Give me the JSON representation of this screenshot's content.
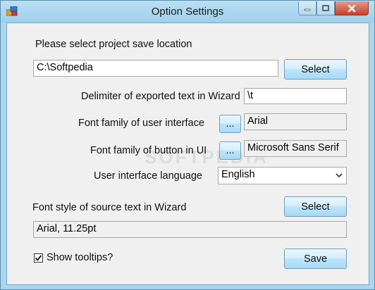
{
  "window": {
    "title": "Option Settings"
  },
  "save_location": {
    "label": "Please select project save location",
    "value": "C:\\Softpedia",
    "select_label": "Select"
  },
  "delimiter": {
    "label": "Delimiter of exported text in Wizard",
    "value": "\\t"
  },
  "ui_font": {
    "label": "Font family of user interface",
    "browse_label": "...",
    "value": "Arial"
  },
  "button_font": {
    "label": "Font family of button in UI",
    "browse_label": "...",
    "value": "Microsoft Sans Serif"
  },
  "language": {
    "label": "User interface language",
    "selected": "English"
  },
  "source_font": {
    "label": "Font style of source text in Wizard",
    "select_label": "Select",
    "value": "Arial, 11.25pt"
  },
  "tooltips": {
    "label": "Show tooltips?",
    "checked": true
  },
  "actions": {
    "save_label": "Save"
  },
  "watermark": "SOFTPEDIA",
  "colors": {
    "frame": "#a9d6f0",
    "button_top": "#eaf6fd",
    "button_bottom": "#a7d9f5",
    "close_button": "#c7412a"
  }
}
